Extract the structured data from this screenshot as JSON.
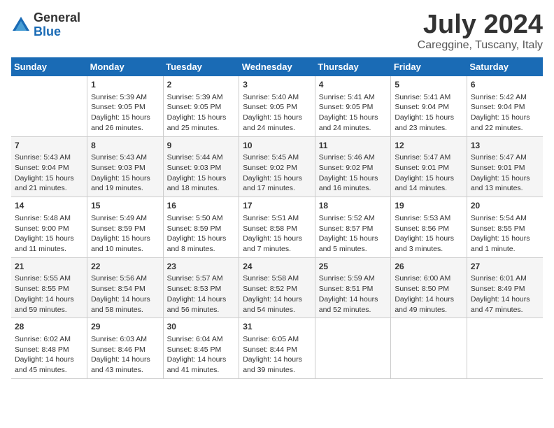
{
  "logo": {
    "general": "General",
    "blue": "Blue"
  },
  "title": {
    "month_year": "July 2024",
    "location": "Careggine, Tuscany, Italy"
  },
  "days_of_week": [
    "Sunday",
    "Monday",
    "Tuesday",
    "Wednesday",
    "Thursday",
    "Friday",
    "Saturday"
  ],
  "weeks": [
    [
      {
        "day": "",
        "info": ""
      },
      {
        "day": "1",
        "info": "Sunrise: 5:39 AM\nSunset: 9:05 PM\nDaylight: 15 hours\nand 26 minutes."
      },
      {
        "day": "2",
        "info": "Sunrise: 5:39 AM\nSunset: 9:05 PM\nDaylight: 15 hours\nand 25 minutes."
      },
      {
        "day": "3",
        "info": "Sunrise: 5:40 AM\nSunset: 9:05 PM\nDaylight: 15 hours\nand 24 minutes."
      },
      {
        "day": "4",
        "info": "Sunrise: 5:41 AM\nSunset: 9:05 PM\nDaylight: 15 hours\nand 24 minutes."
      },
      {
        "day": "5",
        "info": "Sunrise: 5:41 AM\nSunset: 9:04 PM\nDaylight: 15 hours\nand 23 minutes."
      },
      {
        "day": "6",
        "info": "Sunrise: 5:42 AM\nSunset: 9:04 PM\nDaylight: 15 hours\nand 22 minutes."
      }
    ],
    [
      {
        "day": "7",
        "info": "Sunrise: 5:43 AM\nSunset: 9:04 PM\nDaylight: 15 hours\nand 21 minutes."
      },
      {
        "day": "8",
        "info": "Sunrise: 5:43 AM\nSunset: 9:03 PM\nDaylight: 15 hours\nand 19 minutes."
      },
      {
        "day": "9",
        "info": "Sunrise: 5:44 AM\nSunset: 9:03 PM\nDaylight: 15 hours\nand 18 minutes."
      },
      {
        "day": "10",
        "info": "Sunrise: 5:45 AM\nSunset: 9:02 PM\nDaylight: 15 hours\nand 17 minutes."
      },
      {
        "day": "11",
        "info": "Sunrise: 5:46 AM\nSunset: 9:02 PM\nDaylight: 15 hours\nand 16 minutes."
      },
      {
        "day": "12",
        "info": "Sunrise: 5:47 AM\nSunset: 9:01 PM\nDaylight: 15 hours\nand 14 minutes."
      },
      {
        "day": "13",
        "info": "Sunrise: 5:47 AM\nSunset: 9:01 PM\nDaylight: 15 hours\nand 13 minutes."
      }
    ],
    [
      {
        "day": "14",
        "info": "Sunrise: 5:48 AM\nSunset: 9:00 PM\nDaylight: 15 hours\nand 11 minutes."
      },
      {
        "day": "15",
        "info": "Sunrise: 5:49 AM\nSunset: 8:59 PM\nDaylight: 15 hours\nand 10 minutes."
      },
      {
        "day": "16",
        "info": "Sunrise: 5:50 AM\nSunset: 8:59 PM\nDaylight: 15 hours\nand 8 minutes."
      },
      {
        "day": "17",
        "info": "Sunrise: 5:51 AM\nSunset: 8:58 PM\nDaylight: 15 hours\nand 7 minutes."
      },
      {
        "day": "18",
        "info": "Sunrise: 5:52 AM\nSunset: 8:57 PM\nDaylight: 15 hours\nand 5 minutes."
      },
      {
        "day": "19",
        "info": "Sunrise: 5:53 AM\nSunset: 8:56 PM\nDaylight: 15 hours\nand 3 minutes."
      },
      {
        "day": "20",
        "info": "Sunrise: 5:54 AM\nSunset: 8:55 PM\nDaylight: 15 hours\nand 1 minute."
      }
    ],
    [
      {
        "day": "21",
        "info": "Sunrise: 5:55 AM\nSunset: 8:55 PM\nDaylight: 14 hours\nand 59 minutes."
      },
      {
        "day": "22",
        "info": "Sunrise: 5:56 AM\nSunset: 8:54 PM\nDaylight: 14 hours\nand 58 minutes."
      },
      {
        "day": "23",
        "info": "Sunrise: 5:57 AM\nSunset: 8:53 PM\nDaylight: 14 hours\nand 56 minutes."
      },
      {
        "day": "24",
        "info": "Sunrise: 5:58 AM\nSunset: 8:52 PM\nDaylight: 14 hours\nand 54 minutes."
      },
      {
        "day": "25",
        "info": "Sunrise: 5:59 AM\nSunset: 8:51 PM\nDaylight: 14 hours\nand 52 minutes."
      },
      {
        "day": "26",
        "info": "Sunrise: 6:00 AM\nSunset: 8:50 PM\nDaylight: 14 hours\nand 49 minutes."
      },
      {
        "day": "27",
        "info": "Sunrise: 6:01 AM\nSunset: 8:49 PM\nDaylight: 14 hours\nand 47 minutes."
      }
    ],
    [
      {
        "day": "28",
        "info": "Sunrise: 6:02 AM\nSunset: 8:48 PM\nDaylight: 14 hours\nand 45 minutes."
      },
      {
        "day": "29",
        "info": "Sunrise: 6:03 AM\nSunset: 8:46 PM\nDaylight: 14 hours\nand 43 minutes."
      },
      {
        "day": "30",
        "info": "Sunrise: 6:04 AM\nSunset: 8:45 PM\nDaylight: 14 hours\nand 41 minutes."
      },
      {
        "day": "31",
        "info": "Sunrise: 6:05 AM\nSunset: 8:44 PM\nDaylight: 14 hours\nand 39 minutes."
      },
      {
        "day": "",
        "info": ""
      },
      {
        "day": "",
        "info": ""
      },
      {
        "day": "",
        "info": ""
      }
    ]
  ]
}
